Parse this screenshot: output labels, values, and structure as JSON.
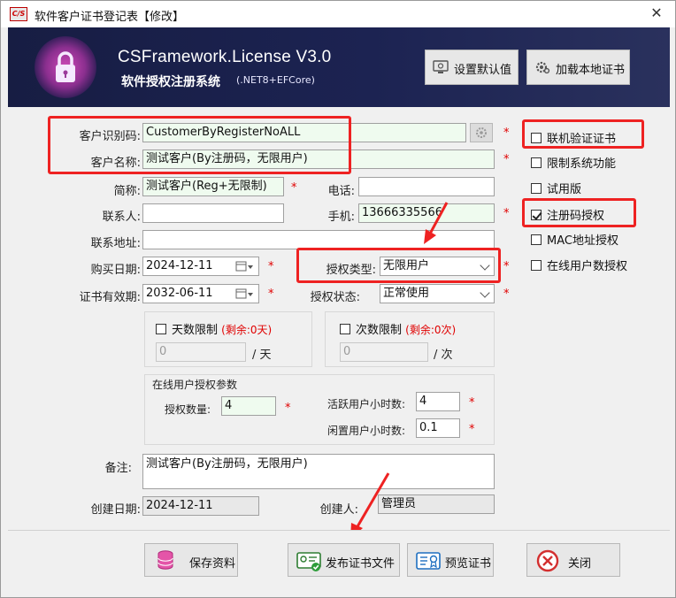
{
  "window": {
    "icon_text": "C/S",
    "title": "软件客户证书登记表【修改】",
    "close_symbol": "✕"
  },
  "banner": {
    "product_title": "CSFramework.License V3.0",
    "product_subtitle": "软件授权注册系统",
    "product_platform": "(.NET8+EFCore)",
    "set_default_label": "设置默认值",
    "load_cert_label": "加载本地证书"
  },
  "form": {
    "customer_code_label": "客户识别码:",
    "customer_code_value": "CustomerByRegisterNoALL",
    "customer_name_label": "客户名称:",
    "customer_name_value": "测试客户(By注册码，无限用户)",
    "short_name_label": "简称:",
    "short_name_value": "测试客户(Reg+无限制)",
    "phone_label": "电话:",
    "phone_value": "",
    "contact_label": "联系人:",
    "contact_value": "",
    "mobile_label": "手机:",
    "mobile_value": "13666335566",
    "address_label": "联系地址:",
    "address_value": "",
    "purchase_date_label": "购买日期:",
    "purchase_date_value": "2024-12-11",
    "expire_date_label": "证书有效期:",
    "expire_date_value": "2032-06-11",
    "license_type_label": "授权类型:",
    "license_type_value": "无限用户",
    "license_status_label": "授权状态:",
    "license_status_value": "正常使用",
    "day_limit_label": "天数限制",
    "day_remaining": "(剩余:0天)",
    "day_limit_value": "0",
    "day_unit": "/ 天",
    "count_limit_label": "次数限制",
    "count_remaining": "(剩余:0次)",
    "count_limit_value": "0",
    "count_unit": "/ 次",
    "online_group_title": "在线用户授权参数",
    "license_qty_label": "授权数量:",
    "license_qty_value": "4",
    "active_hours_label": "活跃用户小时数:",
    "active_hours_value": "4",
    "idle_hours_label": "闲置用户小时数:",
    "idle_hours_value": "0.1",
    "remark_label": "备注:",
    "remark_value": "测试客户(By注册码，无限用户)",
    "create_date_label": "创建日期:",
    "create_date_value": "2024-12-11",
    "creator_label": "创建人:",
    "creator_value": "管理员",
    "required_mark": "*"
  },
  "options": [
    {
      "label": "联机验证证书",
      "checked": false
    },
    {
      "label": "限制系统功能",
      "checked": false
    },
    {
      "label": "试用版",
      "checked": false
    },
    {
      "label": "注册码授权",
      "checked": true
    },
    {
      "label": "MAC地址授权",
      "checked": false
    },
    {
      "label": "在线用户数授权",
      "checked": false
    }
  ],
  "footer": {
    "save_label": "保存资料",
    "publish_label": "发布证书文件",
    "preview_label": "预览证书",
    "close_label": "关闭"
  },
  "colors": {
    "banner": "#1c2352",
    "highlight": "#e22222",
    "required": "#e00000",
    "input_highlight": "#effbef"
  }
}
